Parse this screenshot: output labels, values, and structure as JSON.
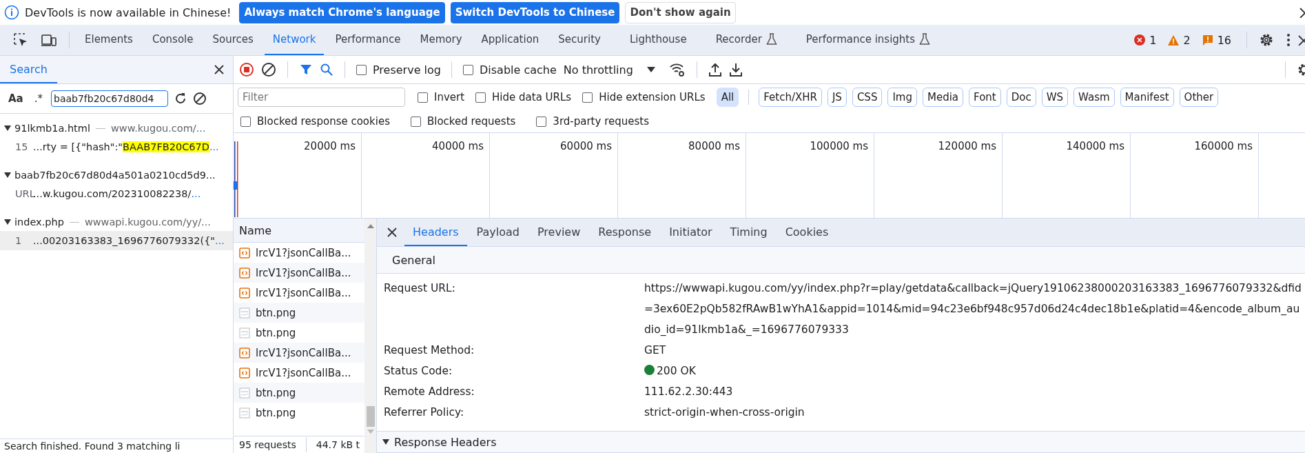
{
  "infobar": {
    "message": "DevTools is now available in Chinese!",
    "buttons": [
      {
        "label": "Always match Chrome's language",
        "primary": true
      },
      {
        "label": "Switch DevTools to Chinese",
        "primary": true
      },
      {
        "label": "Don't show again",
        "primary": false
      }
    ]
  },
  "panel_tabs": [
    {
      "label": "Elements",
      "selected": false,
      "experimental": false
    },
    {
      "label": "Console",
      "selected": false,
      "experimental": false
    },
    {
      "label": "Sources",
      "selected": false,
      "experimental": false
    },
    {
      "label": "Network",
      "selected": true,
      "experimental": false
    },
    {
      "label": "Performance",
      "selected": false,
      "experimental": false
    },
    {
      "label": "Memory",
      "selected": false,
      "experimental": false
    },
    {
      "label": "Application",
      "selected": false,
      "experimental": false
    },
    {
      "label": "Security",
      "selected": false,
      "experimental": false
    },
    {
      "label": "Lighthouse",
      "selected": false,
      "experimental": false
    },
    {
      "label": "Recorder",
      "selected": false,
      "experimental": true
    },
    {
      "label": "Performance insights",
      "selected": false,
      "experimental": true
    }
  ],
  "counters": [
    {
      "kind": "error",
      "count": "1"
    },
    {
      "kind": "warning",
      "count": "2"
    },
    {
      "kind": "issue",
      "count": "16"
    }
  ],
  "search": {
    "title": "Search",
    "match_case": "Aa",
    "regex": ".*",
    "query": "baab7fb20c67d80d4",
    "results": [
      {
        "file": "91lkmb1a.html",
        "url": "www.kugou.com/...",
        "expanded": true,
        "matches": [
          {
            "line": "15",
            "text": "...rty = [{\"hash\":\"",
            "highlight": "BAAB7FB20C67D",
            "more": "...",
            "selected": false
          }
        ]
      },
      {
        "file": "baab7fb20c67d80d4a501a0210cd5d9...",
        "expanded": true,
        "matches": [
          {
            "line": "URL",
            "text": "...w.kugou.com/202310082238/",
            "more": "...",
            "selected": false
          }
        ]
      },
      {
        "file": "index.php",
        "url": "wwwapi.kugou.com/yy/...",
        "expanded": true,
        "matches": [
          {
            "line": "1",
            "text": "...00203163383_1696776079332({\"",
            "more": "...",
            "selected": true
          }
        ]
      }
    ],
    "status": "Search finished. Found 3 matching li"
  },
  "network": {
    "recording": true,
    "filter_active": true,
    "toolbar_options": [
      {
        "label": "Preserve log",
        "checked": false
      },
      {
        "label": "Disable cache",
        "checked": false
      }
    ],
    "throttling": "No throttling",
    "filter": {
      "placeholder": "Filter",
      "options": [
        {
          "label": "Invert",
          "checked": false
        },
        {
          "label": "Hide data URLs",
          "checked": false
        },
        {
          "label": "Hide extension URLs",
          "checked": false
        }
      ],
      "types": [
        {
          "label": "All",
          "selected": true
        },
        {
          "label": "Fetch/XHR",
          "selected": false
        },
        {
          "label": "JS",
          "selected": false
        },
        {
          "label": "CSS",
          "selected": false
        },
        {
          "label": "Img",
          "selected": false
        },
        {
          "label": "Media",
          "selected": false
        },
        {
          "label": "Font",
          "selected": false
        },
        {
          "label": "Doc",
          "selected": false
        },
        {
          "label": "WS",
          "selected": false
        },
        {
          "label": "Wasm",
          "selected": false
        },
        {
          "label": "Manifest",
          "selected": false
        },
        {
          "label": "Other",
          "selected": false
        }
      ]
    },
    "more_options": [
      {
        "label": "Blocked response cookies",
        "checked": false
      },
      {
        "label": "Blocked requests",
        "checked": false
      },
      {
        "label": "3rd-party requests",
        "checked": false
      }
    ],
    "timeline_ticks": [
      "20000 ms",
      "40000 ms",
      "60000 ms",
      "80000 ms",
      "100000 ms",
      "120000 ms",
      "140000 ms",
      "160000 ms"
    ],
    "requests": {
      "header": "Name",
      "rows": [
        {
          "name": "lrcV1?jsonCallBa...",
          "kind": "script"
        },
        {
          "name": "lrcV1?jsonCallBa...",
          "kind": "script"
        },
        {
          "name": "lrcV1?jsonCallBa...",
          "kind": "script"
        },
        {
          "name": "btn.png",
          "kind": "image"
        },
        {
          "name": "btn.png",
          "kind": "image"
        },
        {
          "name": "lrcV1?jsonCallBa...",
          "kind": "script"
        },
        {
          "name": "lrcV1?jsonCallBa...",
          "kind": "script"
        },
        {
          "name": "btn.png",
          "kind": "image"
        },
        {
          "name": "btn.png",
          "kind": "image"
        }
      ]
    },
    "summary": [
      "95 requests",
      "44.7 kB t"
    ]
  },
  "details": {
    "tabs": [
      {
        "label": "Headers",
        "selected": true
      },
      {
        "label": "Payload",
        "selected": false
      },
      {
        "label": "Preview",
        "selected": false
      },
      {
        "label": "Response",
        "selected": false
      },
      {
        "label": "Initiator",
        "selected": false
      },
      {
        "label": "Timing",
        "selected": false
      },
      {
        "label": "Cookies",
        "selected": false
      }
    ],
    "general": {
      "title": "General",
      "rows": [
        {
          "label": "Request URL:",
          "value": "https://wwwapi.kugou.com/yy/index.php?r=play/getdata&callback=jQuery19106238000203163383_1696776079332&dfid=3ex60E2pQb582fRAwB1wYhA1&appid=1014&mid=94c23e6bf948c957d06d24c4dec18b1e&platid=4&encode_album_audio_id=91lkmb1a&_=1696776079333"
        },
        {
          "label": "Request Method:",
          "value": "GET"
        },
        {
          "label": "Status Code:",
          "value": "200 OK",
          "color": "#1a7f37"
        },
        {
          "label": "Remote Address:",
          "value": "111.62.2.30:443"
        },
        {
          "label": "Referrer Policy:",
          "value": "strict-origin-when-cross-origin"
        }
      ]
    },
    "response_headers": {
      "title": "Response Headers",
      "expanded": true
    }
  }
}
